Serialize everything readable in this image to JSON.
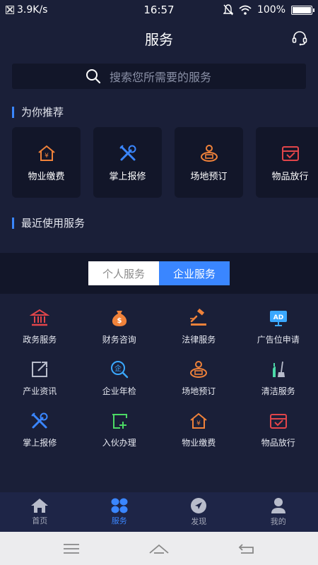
{
  "status": {
    "net_speed": "3.9K/s",
    "time": "16:57",
    "battery": "100%",
    "battery_level": 1.0
  },
  "header": {
    "title": "服务"
  },
  "search": {
    "placeholder": "搜索您所需要的服务"
  },
  "recommend": {
    "title": "为你推荐",
    "items": [
      {
        "label": "物业缴费",
        "icon": "property-fee-icon"
      },
      {
        "label": "掌上报修",
        "icon": "repair-icon"
      },
      {
        "label": "场地预订",
        "icon": "venue-booking-icon"
      },
      {
        "label": "物品放行",
        "icon": "item-release-icon"
      }
    ]
  },
  "recent": {
    "title": "最近使用服务"
  },
  "tabs": {
    "personal": "个人服务",
    "enterprise": "企业服务",
    "active": "enterprise"
  },
  "services": [
    {
      "label": "政务服务",
      "icon": "government-icon"
    },
    {
      "label": "财务咨询",
      "icon": "money-bag-icon"
    },
    {
      "label": "法律服务",
      "icon": "gavel-icon"
    },
    {
      "label": "广告位申请",
      "icon": "ad-icon"
    },
    {
      "label": "产业资讯",
      "icon": "external-link-icon"
    },
    {
      "label": "企业年检",
      "icon": "enterprise-check-icon"
    },
    {
      "label": "场地预订",
      "icon": "venue-booking-icon"
    },
    {
      "label": "清洁服务",
      "icon": "cleaning-icon"
    },
    {
      "label": "掌上报修",
      "icon": "repair-icon"
    },
    {
      "label": "入伙办理",
      "icon": "move-in-icon"
    },
    {
      "label": "物业缴费",
      "icon": "property-fee-icon"
    },
    {
      "label": "物品放行",
      "icon": "item-release-icon"
    }
  ],
  "nav": [
    {
      "label": "首页",
      "icon": "home-icon"
    },
    {
      "label": "服务",
      "icon": "services-icon"
    },
    {
      "label": "发现",
      "icon": "discover-icon"
    },
    {
      "label": "我的",
      "icon": "profile-icon"
    }
  ],
  "colors": {
    "accent": "#3a86ff",
    "background": "#1a1f38",
    "card": "#121629",
    "orange": "#f0823a",
    "red": "#e2454a",
    "blue": "#3a86ff",
    "green": "#4cd964"
  }
}
